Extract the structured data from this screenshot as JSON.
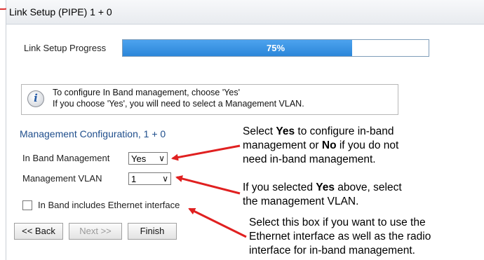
{
  "window": {
    "title": "Link Setup (PIPE) 1 + 0"
  },
  "progress": {
    "label": "Link Setup Progress",
    "value_text": "75%",
    "value": 0.75
  },
  "info": {
    "line1": "To configure In Band management, choose 'Yes'",
    "line2": "If you choose 'Yes', you will need to select a Management VLAN."
  },
  "management": {
    "section_title": "Management Configuration, 1 + 0",
    "in_band_label": "In Band Management",
    "in_band_value": "Yes",
    "vlan_label": "Management VLAN",
    "vlan_value": "1",
    "eth_checkbox_label": "In Band includes Ethernet interface",
    "eth_checked": false
  },
  "buttons": {
    "back": "<< Back",
    "next": "Next >>",
    "finish": "Finish"
  },
  "callouts": {
    "c1": {
      "p1": "Select ",
      "b1": "Yes",
      "p2": " to configure in-band",
      "line2a": "management or ",
      "b2": "No",
      "line2b": " if you do not",
      "line3": "need in-band management."
    },
    "c2": {
      "p1": "If you selected ",
      "b1": "Yes",
      "p2": " above, select",
      "line2": "the management VLAN."
    },
    "c3": {
      "line1": "Select this box if you want to use the",
      "line2": "Ethernet interface as well as the radio",
      "line3": "interface for in-band management."
    }
  },
  "colors": {
    "accent": "#2b86d9",
    "annotation": "#e02020",
    "section_title": "#1f4e8c"
  },
  "icons": {
    "info": "info-icon",
    "dropdown": "chevron-down-icon"
  }
}
